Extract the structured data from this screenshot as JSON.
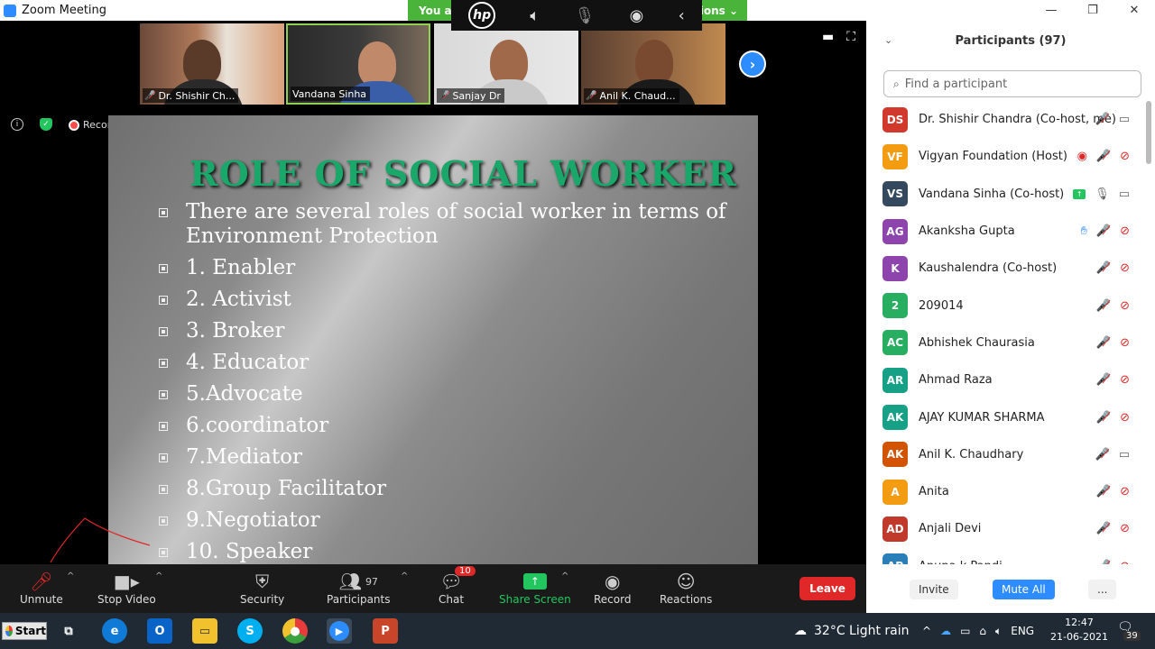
{
  "window": {
    "title": "Zoom Meeting"
  },
  "banner": {
    "text": "You ar",
    "options": "tions"
  },
  "video_tiles": [
    {
      "name": "Dr. Shishir Ch...",
      "muted": true
    },
    {
      "name": "Vandana Sinha",
      "muted": false
    },
    {
      "name": "Sanjay Dr",
      "muted": true
    },
    {
      "name": "Anil K. Chaud...",
      "muted": true
    }
  ],
  "status": {
    "recording": "Recording"
  },
  "slide": {
    "title": "ROLE OF SOCIAL WORKER",
    "bullets": [
      "There are several roles of social worker in terms of Environment Protection",
      "1. Enabler",
      "2. Activist",
      "3. Broker",
      "4. Educator",
      "5.Advocate",
      "6.coordinator",
      "7.Mediator",
      "8.Group Facilitator",
      "9.Negotiator",
      "10. Speaker"
    ]
  },
  "toolbar": {
    "unmute": "Unmute",
    "stop_video": "Stop Video",
    "security": "Security",
    "participants": "Participants",
    "participants_count": "97",
    "chat": "Chat",
    "chat_badge": "10",
    "share_screen": "Share Screen",
    "record": "Record",
    "reactions": "Reactions",
    "leave": "Leave"
  },
  "panel": {
    "title": "Participants (97)",
    "search_placeholder": "Find a participant",
    "participants": [
      {
        "initials": "DS",
        "name": "Dr. Shishir Chandra (Co-host, me)",
        "color": "#d0392b"
      },
      {
        "initials": "VF",
        "name": "Vigyan Foundation (Host)",
        "color": "#f39c12"
      },
      {
        "initials": "VS",
        "name": "Vandana Sinha (Co-host)",
        "color": "#34495e"
      },
      {
        "initials": "AG",
        "name": "Akanksha Gupta",
        "color": "#8e44ad"
      },
      {
        "initials": "K",
        "name": "Kaushalendra (Co-host)",
        "color": "#8e44ad"
      },
      {
        "initials": "2",
        "name": "209014",
        "color": "#27ae60"
      },
      {
        "initials": "AC",
        "name": "Abhishek Chaurasia",
        "color": "#27ae60"
      },
      {
        "initials": "AR",
        "name": "Ahmad Raza",
        "color": "#16a085"
      },
      {
        "initials": "AK",
        "name": "AJAY KUMAR SHARMA",
        "color": "#16a085"
      },
      {
        "initials": "AK",
        "name": "Anil K. Chaudhary",
        "color": "#d35400"
      },
      {
        "initials": "A",
        "name": "Anita",
        "color": "#f39c12"
      },
      {
        "initials": "AD",
        "name": "Anjali Devi",
        "color": "#c0392b"
      },
      {
        "initials": "AP",
        "name": "Anupa k Pandi...",
        "color": "#2980b9"
      }
    ],
    "invite": "Invite",
    "mute_all": "Mute All",
    "more": "..."
  },
  "taskbar": {
    "start": "Start",
    "weather": "32°C  Light rain",
    "lang": "ENG",
    "time": "12:47",
    "date": "21-06-2021",
    "notifications": "39"
  }
}
